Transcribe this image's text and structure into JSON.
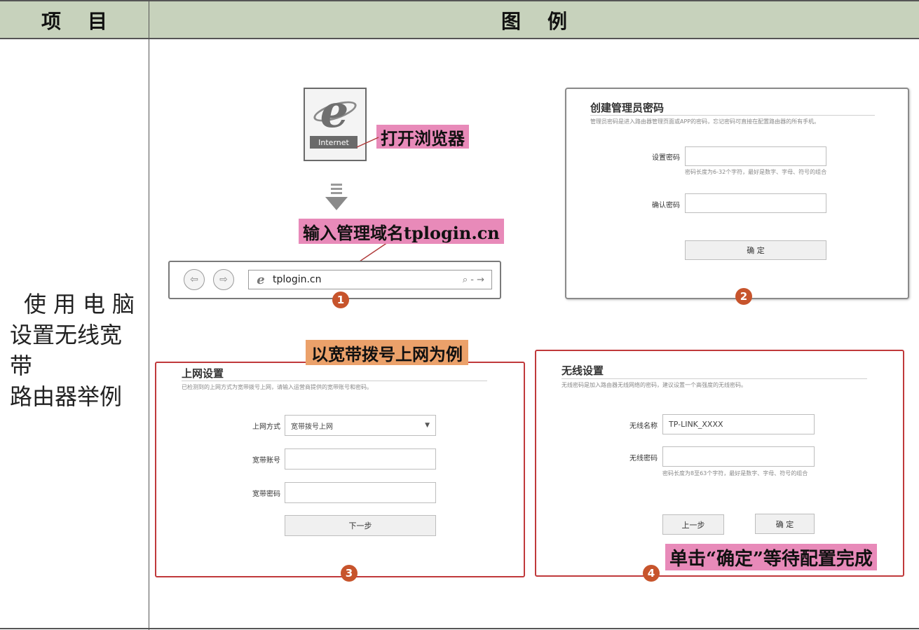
{
  "table": {
    "header_item": "项目",
    "header_example": "图例",
    "row_label_line1": "使用电脑",
    "row_label_line2": "设置无线宽带",
    "row_label_line3": "路由器举例"
  },
  "step1": {
    "ie_label": "Internet",
    "callout_open_browser": "打开浏览器",
    "callout_enter_domain": "输入管理域名tplogin.cn",
    "url_text": "tplogin.cn",
    "url_icons": "⌕ - →",
    "badge": "1"
  },
  "step2": {
    "title": "创建管理员密码",
    "subtitle": "管理员密码是进入路由器管理页面或APP的密码，忘记密码可直接在配置路由器的所有手机。",
    "set_password_label": "设置密码",
    "set_password_hint": "密码长度为6-32个字符，最好是数字、字母、符号的组合",
    "confirm_password_label": "确认密码",
    "confirm_button": "确 定",
    "badge": "2"
  },
  "step3": {
    "callout": "以宽带拨号上网为例",
    "title": "上网设置",
    "subtitle": "已检测到的上网方式为宽带拨号上网，请输入运营商提供的宽带账号和密码。",
    "method_label": "上网方式",
    "method_value": "宽带拨号上网",
    "account_label": "宽带账号",
    "password_label": "宽带密码",
    "next_button": "下一步",
    "badge": "3"
  },
  "step4": {
    "title": "无线设置",
    "subtitle": "无线密码是加入路由器无线网络的密码，建议设置一个高强度的无线密码。",
    "ssid_label": "无线名称",
    "ssid_value": "TP-LINK_XXXX",
    "wifi_password_label": "无线密码",
    "wifi_password_hint": "密码长度为8至63个字符，最好是数字、字母、符号的组合",
    "prev_button": "上一步",
    "confirm_button": "确 定",
    "callout": "单击“确定”等待配置完成",
    "badge": "4"
  },
  "colors": {
    "header_bg": "#c7d2bc",
    "callout_pink": "#e88ab9",
    "callout_orange": "#eba16a",
    "panel_red_border": "#c0393b",
    "badge": "#c7542c"
  }
}
